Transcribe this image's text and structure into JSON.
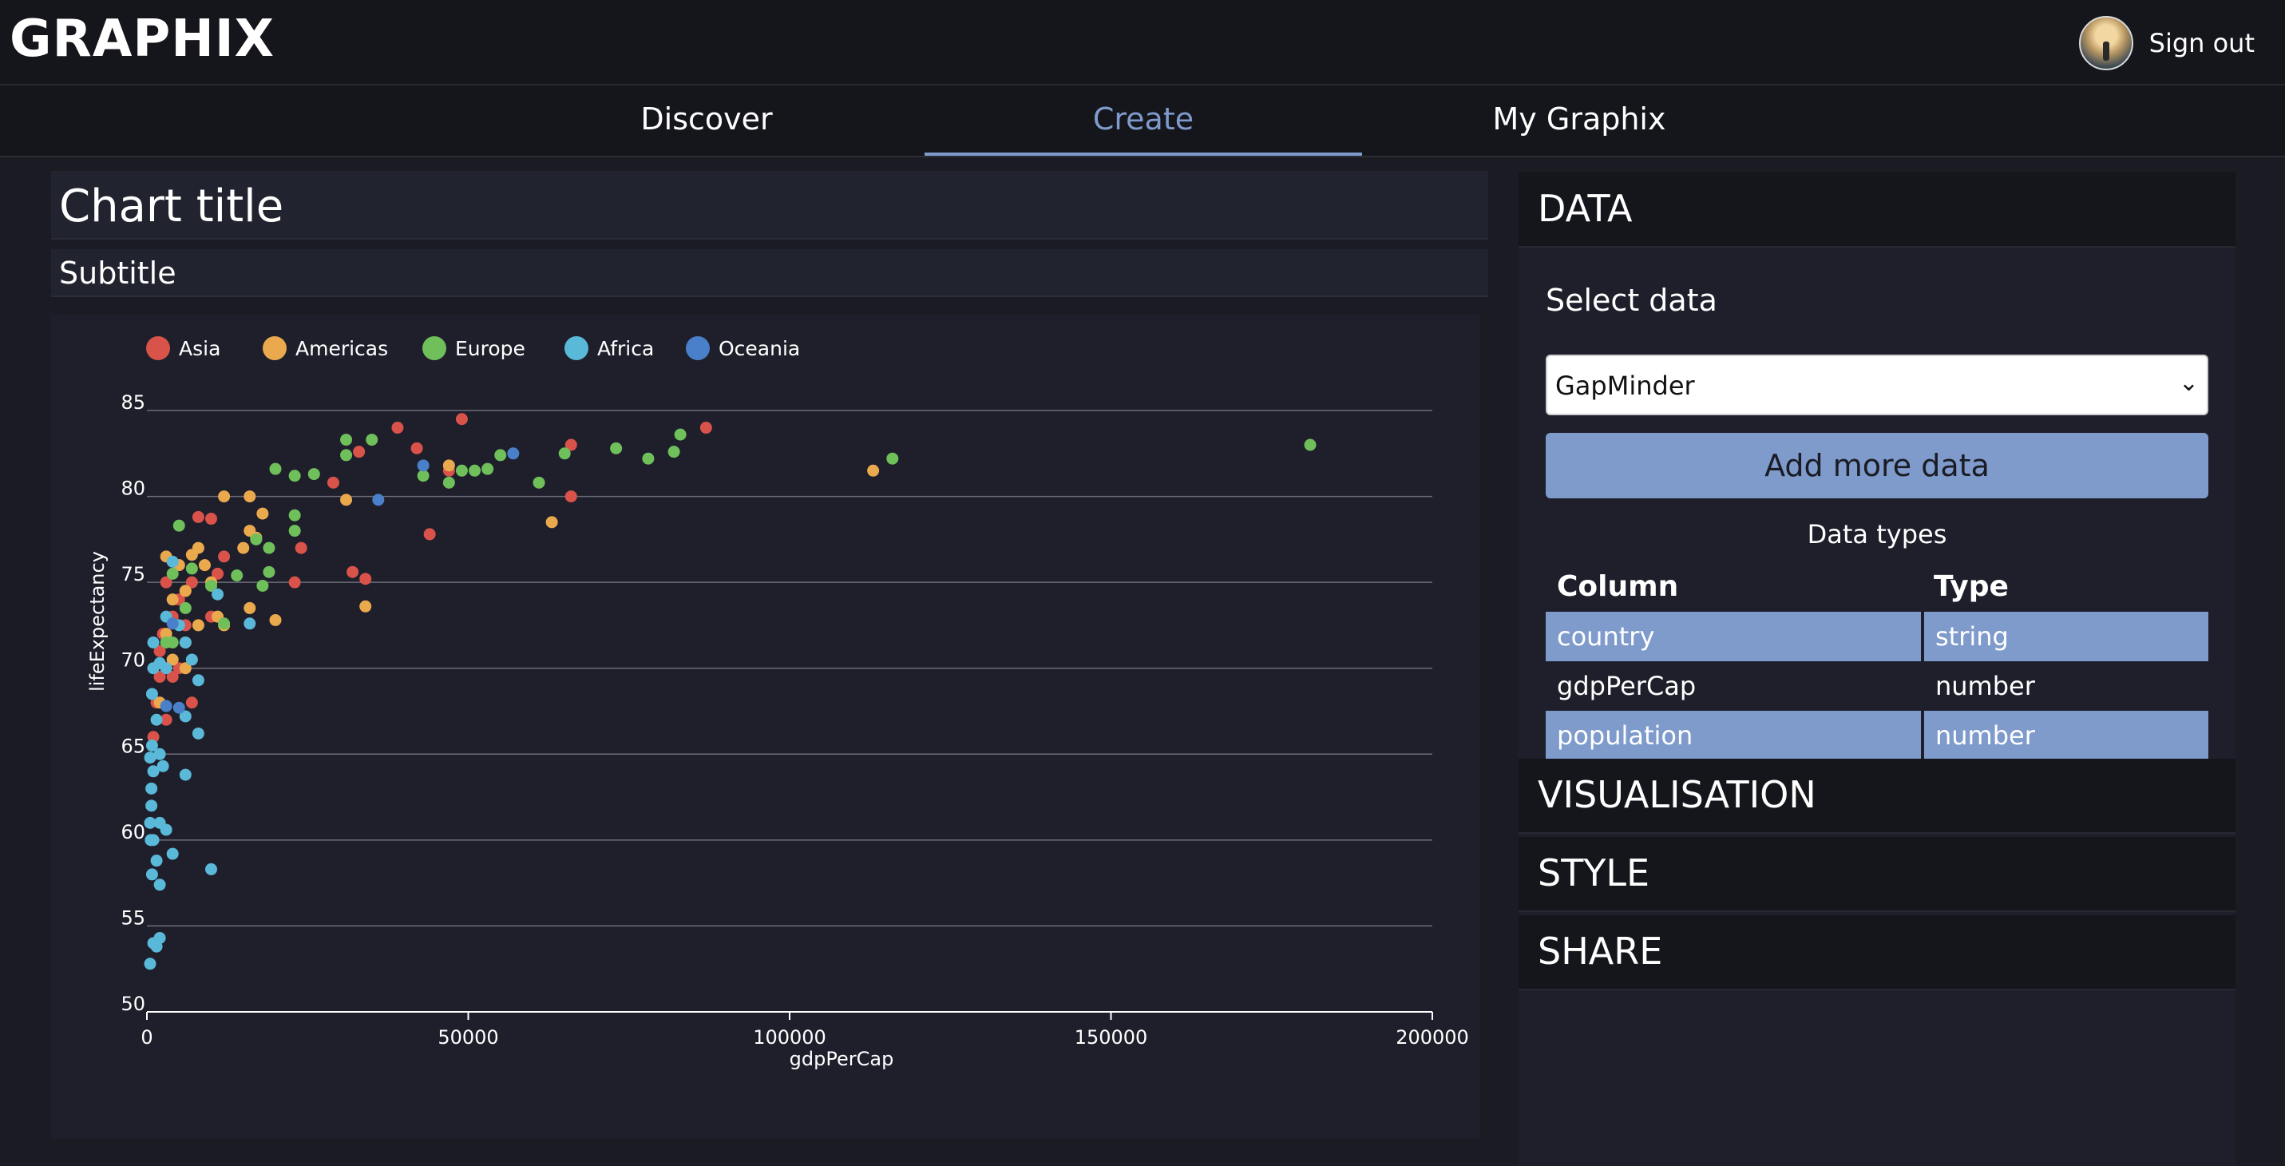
{
  "app": {
    "brand": "GRAPHIX",
    "sign_out": "Sign out"
  },
  "nav": {
    "tabs": [
      "Discover",
      "Create",
      "My Graphix"
    ],
    "active": "Create"
  },
  "editor": {
    "title_placeholder": "Chart title",
    "subtitle_placeholder": "Subtitle"
  },
  "colors": {
    "accent": "#7f9bcc",
    "asia": "#d9534b",
    "americas": "#eba94e",
    "europe": "#6fbf5b",
    "africa": "#5ab8d9",
    "oceania": "#4a80c9"
  },
  "chart_data": {
    "type": "scatter",
    "title": "Chart title",
    "subtitle": "Subtitle",
    "xlabel": "gdpPerCap",
    "ylabel": "lifeExpectancy",
    "xlim": [
      0,
      200000
    ],
    "ylim": [
      50,
      85
    ],
    "x_ticks": [
      "0",
      "50000",
      "100000",
      "150000",
      "200000"
    ],
    "y_ticks": [
      "50",
      "55",
      "60",
      "65",
      "70",
      "75",
      "80",
      "85"
    ],
    "grid": "horizontal",
    "legend": "top-left",
    "series": [
      {
        "name": "Asia",
        "color": "#d9534b",
        "points": [
          [
            49000,
            84.5
          ],
          [
            87000,
            84
          ],
          [
            66000,
            83
          ],
          [
            39000,
            84
          ],
          [
            42000,
            82.8
          ],
          [
            33000,
            82.6
          ],
          [
            29000,
            80.8
          ],
          [
            47000,
            81.5
          ],
          [
            66000,
            80
          ],
          [
            44000,
            77.8
          ],
          [
            32000,
            75.6
          ],
          [
            34000,
            75.2
          ],
          [
            24000,
            77
          ],
          [
            23000,
            75
          ],
          [
            8000,
            78.8
          ],
          [
            10000,
            78.7
          ],
          [
            12000,
            76.5
          ],
          [
            9000,
            76
          ],
          [
            11000,
            75.5
          ],
          [
            7000,
            75
          ],
          [
            6000,
            74.5
          ],
          [
            5000,
            74
          ],
          [
            3000,
            75
          ],
          [
            4000,
            73
          ],
          [
            2500,
            72
          ],
          [
            2000,
            71
          ],
          [
            3000,
            70
          ],
          [
            4000,
            69.5
          ],
          [
            5000,
            70
          ],
          [
            2000,
            69.5
          ],
          [
            1500,
            68
          ],
          [
            7000,
            68
          ],
          [
            3000,
            67
          ],
          [
            1000,
            66
          ],
          [
            6000,
            72.5
          ],
          [
            10000,
            73
          ],
          [
            5000,
            76
          ]
        ]
      },
      {
        "name": "Americas",
        "color": "#eba94e",
        "points": [
          [
            113000,
            81.5
          ],
          [
            47000,
            81.8
          ],
          [
            63000,
            78.5
          ],
          [
            34000,
            73.6
          ],
          [
            31000,
            79.8
          ],
          [
            18000,
            79
          ],
          [
            16000,
            78
          ],
          [
            12000,
            80
          ],
          [
            16000,
            80
          ],
          [
            17000,
            77.6
          ],
          [
            15000,
            77
          ],
          [
            8000,
            77
          ],
          [
            7000,
            76.6
          ],
          [
            9000,
            76
          ],
          [
            10000,
            75
          ],
          [
            6000,
            74.5
          ],
          [
            4000,
            74
          ],
          [
            5000,
            76
          ],
          [
            11000,
            73
          ],
          [
            12000,
            72.5
          ],
          [
            8000,
            72.5
          ],
          [
            6000,
            71.5
          ],
          [
            3000,
            72
          ],
          [
            4000,
            70.5
          ],
          [
            6000,
            70
          ],
          [
            2000,
            68
          ],
          [
            16000,
            73.5
          ],
          [
            20000,
            72.8
          ],
          [
            3000,
            76.5
          ]
        ]
      },
      {
        "name": "Europe",
        "color": "#6fbf5b",
        "points": [
          [
            181000,
            83
          ],
          [
            116000,
            82.2
          ],
          [
            83000,
            83.6
          ],
          [
            82000,
            82.6
          ],
          [
            78000,
            82.2
          ],
          [
            73000,
            82.8
          ],
          [
            65000,
            82.5
          ],
          [
            61000,
            80.8
          ],
          [
            55000,
            82.4
          ],
          [
            53000,
            81.6
          ],
          [
            51000,
            81.5
          ],
          [
            49000,
            81.5
          ],
          [
            47000,
            80.8
          ],
          [
            43000,
            81.2
          ],
          [
            35000,
            83.3
          ],
          [
            31000,
            83.3
          ],
          [
            31000,
            82.4
          ],
          [
            26000,
            81.3
          ],
          [
            23000,
            81.2
          ],
          [
            20000,
            81.6
          ],
          [
            23000,
            78.9
          ],
          [
            23000,
            78
          ],
          [
            19000,
            77
          ],
          [
            17000,
            77.5
          ],
          [
            19000,
            75.6
          ],
          [
            18000,
            74.8
          ],
          [
            14000,
            75.4
          ],
          [
            10000,
            74.8
          ],
          [
            7000,
            75.8
          ],
          [
            5000,
            78.3
          ],
          [
            4000,
            75.5
          ],
          [
            12000,
            72.6
          ],
          [
            6000,
            73.5
          ],
          [
            3000,
            71.5
          ],
          [
            4000,
            71.5
          ]
        ]
      },
      {
        "name": "Africa",
        "color": "#5ab8d9",
        "points": [
          [
            16000,
            72.6
          ],
          [
            11000,
            74.3
          ],
          [
            8000,
            69.3
          ],
          [
            8000,
            66.2
          ],
          [
            6000,
            63.8
          ],
          [
            10000,
            58.3
          ],
          [
            4000,
            59.2
          ],
          [
            3000,
            60.6
          ],
          [
            2000,
            57.4
          ],
          [
            1500,
            58.8
          ],
          [
            800,
            58
          ],
          [
            700,
            62
          ],
          [
            500,
            61
          ],
          [
            1000,
            60
          ],
          [
            600,
            60
          ],
          [
            2000,
            61
          ],
          [
            1500,
            53.8
          ],
          [
            1000,
            54
          ],
          [
            2000,
            54.3
          ],
          [
            500,
            52.8
          ],
          [
            700,
            63
          ],
          [
            1000,
            64
          ],
          [
            2000,
            65
          ],
          [
            1500,
            67
          ],
          [
            800,
            68.5
          ],
          [
            3000,
            70
          ],
          [
            6000,
            71.5
          ],
          [
            5000,
            72.5
          ],
          [
            4000,
            76.2
          ],
          [
            6000,
            67.2
          ],
          [
            7000,
            70.5
          ],
          [
            1000,
            70
          ],
          [
            2000,
            70.3
          ],
          [
            1000,
            71.5
          ],
          [
            3000,
            73
          ],
          [
            800,
            65.5
          ],
          [
            2500,
            64.3
          ],
          [
            500,
            64.8
          ]
        ]
      },
      {
        "name": "Oceania",
        "color": "#4a80c9",
        "points": [
          [
            57000,
            82.5
          ],
          [
            43000,
            81.8
          ],
          [
            36000,
            79.8
          ],
          [
            4000,
            72.6
          ],
          [
            3000,
            67.8
          ],
          [
            5000,
            67.7
          ]
        ]
      }
    ]
  }
}
